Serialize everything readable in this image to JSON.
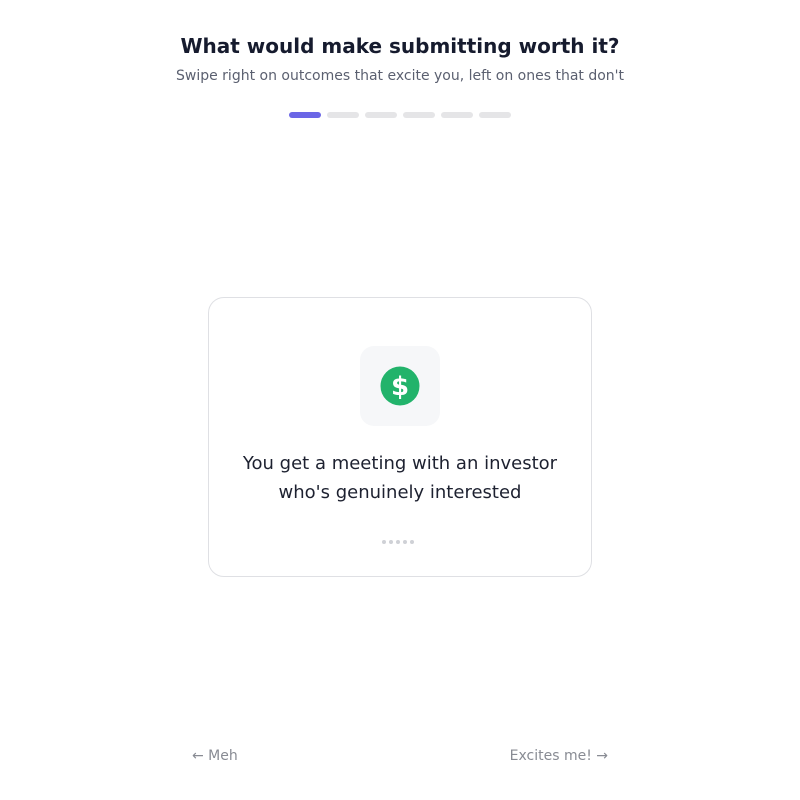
{
  "header": {
    "title": "What would make submitting worth it?",
    "subtitle": "Swipe right on outcomes that excite you, left on ones that don't"
  },
  "progress": {
    "total_steps": 6,
    "current_step": 1,
    "accent_color": "#6b66e6"
  },
  "card": {
    "icon": "dollar-icon",
    "icon_color": "#22b36b",
    "line1": "You get a meeting with an investor",
    "line2": "who's genuinely interested"
  },
  "navigation": {
    "left_label": "← Meh",
    "right_label": "Excites me! →"
  }
}
